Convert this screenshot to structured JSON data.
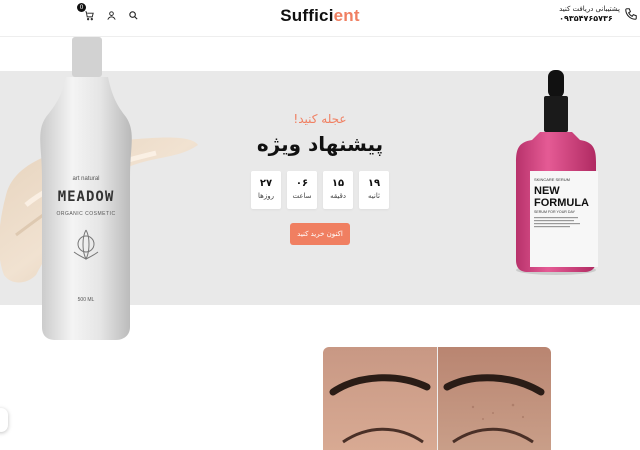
{
  "header": {
    "logo_main": "Suffici",
    "logo_accent": "ent",
    "cart_count": "0",
    "support_label": "پشتیبانی دریافت کنید",
    "support_phone": "۰۹۳۵۴۷۶۵۷۳۶",
    "icons": [
      "cart-icon",
      "user-icon",
      "search-icon",
      "phone-icon"
    ]
  },
  "hero": {
    "hurry_text": "عجله کنید!",
    "title": "پیشنهاد ویژه",
    "countdown": [
      {
        "value": "۱۹",
        "label": "ثانیه"
      },
      {
        "value": "۱۵",
        "label": "دقیقه"
      },
      {
        "value": "۰۶",
        "label": "ساعت"
      },
      {
        "value": "۲۷",
        "label": "روزها"
      }
    ],
    "cta_label": "اکنون خرید کنید",
    "bottle": {
      "brand_small": "art natural",
      "name": "MEADOW",
      "subtitle": "ORGANIC COSMETIC",
      "volume": "500 ML"
    },
    "serum": {
      "top_text": "SKINCARE SERUM",
      "title_line1": "NEW",
      "title_line2": "FORMULA",
      "tagline": "SERUM FOR YOUR DAY"
    }
  },
  "colors": {
    "accent": "#f07f61",
    "hero_bg": "#e9e9e9",
    "serum_pink": "#d84a86"
  }
}
